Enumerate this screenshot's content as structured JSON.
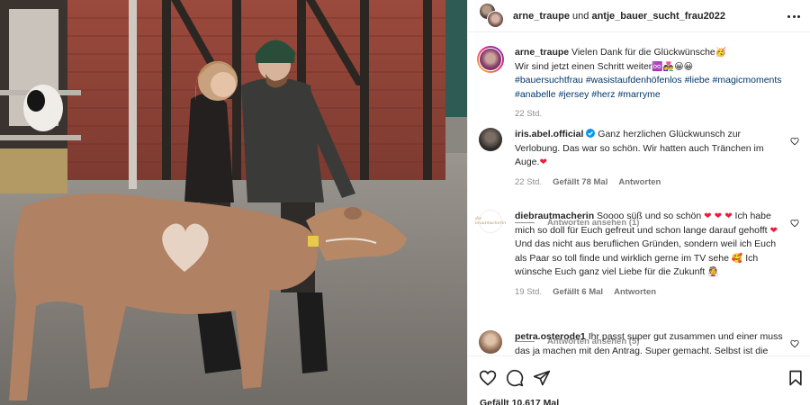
{
  "header": {
    "user1": "arne_traupe",
    "connector": "und",
    "user2": "antje_bauer_sucht_frau2022",
    "more_icon": "more-horizontal-icon"
  },
  "caption": {
    "username": "arne_traupe",
    "text_line1": "Vielen Dank für die Glückwünsche",
    "emoji1": "🥳",
    "text_line2": "Wir sind jetzt einen Schritt weiter",
    "emoji2": "♾️👩‍❤️‍👨😀😀",
    "hashtags": [
      "#bauersuchtfrau",
      "#wasistaufdenhöfenlos",
      "#liebe",
      "#magicmoments",
      "#anabelle",
      "#jersey",
      "#herz",
      "#marryme"
    ],
    "time": "22 Std."
  },
  "comments": [
    {
      "username": "iris.abel.official",
      "verified": true,
      "text": "Ganz herzlichen Glückwunsch zur Verlobung. Das war so schön. Wir hatten auch Tränchen im Auge.",
      "emoji_end": "❤",
      "time": "22 Std.",
      "likes": "Gefällt 78 Mal",
      "reply": "Antworten",
      "view_replies": "Antworten ansehen (1)"
    },
    {
      "username": "diebrautmacherin",
      "avatar_text": "die brautmacherin",
      "text_a": "Soooo süß und so schön",
      "hearts": "❤ ❤ ❤",
      "text_b": "Ich habe mich so doll für Euch gefreut und schon lange darauf gehofft",
      "heart_b": "❤",
      "text_c": "Und das nicht aus beruflichen Gründen, sondern weil ich Euch als Paar so toll finde und wirklich gerne im TV sehe",
      "emoji_c": "🥰",
      "text_d": "Ich wünsche Euch ganz viel Liebe für die Zukunft",
      "emoji_d": "👰",
      "time": "19 Std.",
      "likes": "Gefällt 6 Mal",
      "reply": "Antworten",
      "view_replies": "Antworten ansehen (5)"
    },
    {
      "username": "petra.osterode1",
      "text": "Ihr passt super gut zusammen und einer muss das ja machen mit den Antrag. Super gemacht. Selbst ist die"
    }
  ],
  "actions": {
    "like_icon": "heart-outline-icon",
    "comment_icon": "comment-icon",
    "share_icon": "paper-plane-icon",
    "save_icon": "bookmark-icon",
    "likes_text": "Gefällt 10.617 Mal"
  },
  "colors": {
    "link": "#00376b",
    "muted": "#8e8e8e",
    "verified": "#0095f6",
    "heart": "#ed1c3a"
  }
}
